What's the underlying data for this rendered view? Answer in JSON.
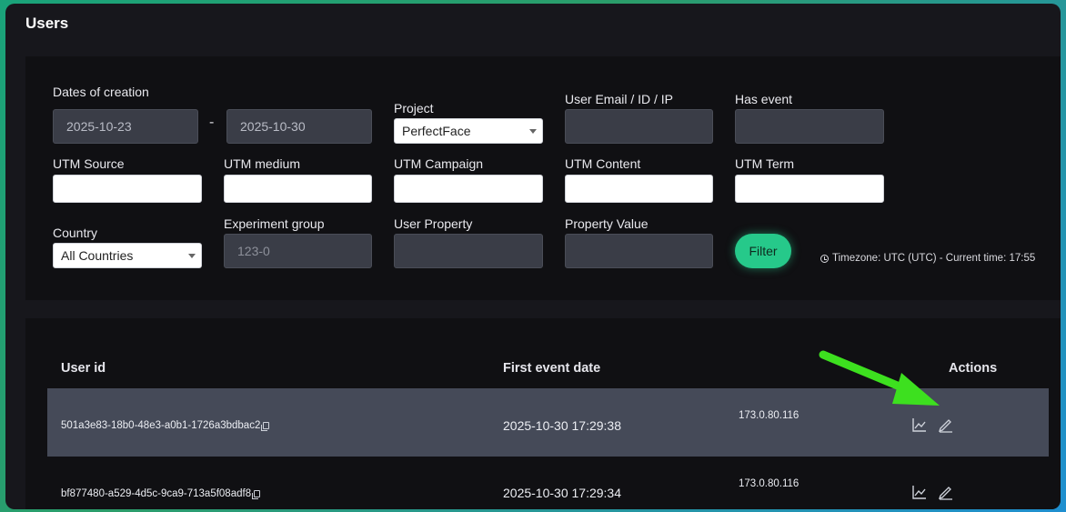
{
  "title": "Users",
  "filters": {
    "dates_label": "Dates of creation",
    "date_from": "2025-10-23",
    "date_separator": "-",
    "date_to": "2025-10-30",
    "project_label": "Project",
    "project_value": "PerfectFace",
    "user_email_label": "User Email / ID / IP",
    "user_email_value": "",
    "has_event_label": "Has event",
    "has_event_value": "",
    "utm_source_label": "UTM Source",
    "utm_medium_label": "UTM medium",
    "utm_campaign_label": "UTM Campaign",
    "utm_content_label": "UTM Content",
    "utm_term_label": "UTM Term",
    "country_label": "Country",
    "country_value": "All Countries",
    "experiment_label": "Experiment group",
    "experiment_placeholder": "123-0",
    "user_property_label": "User Property",
    "property_value_label": "Property Value",
    "filter_button": "Filter",
    "timezone_text": "Timezone: UTC (UTC) - Current time: 17:55"
  },
  "table": {
    "headers": {
      "user_id": "User id",
      "first_event": "First event date",
      "actions": "Actions"
    },
    "rows": [
      {
        "user_id": "501a3e83-18b0-48e3-a0b1-1726a3bdbac2",
        "first_event": "2025-10-30 17:29:38",
        "ip": "173.0.80.116"
      },
      {
        "user_id": "bf877480-a529-4d5c-9ca9-713a5f08adf8",
        "first_event": "2025-10-30 17:29:34",
        "ip": "173.0.80.116"
      }
    ]
  },
  "colors": {
    "accent": "#26c98a",
    "arrow": "#3de01f",
    "row_highlight": "#454a58"
  }
}
